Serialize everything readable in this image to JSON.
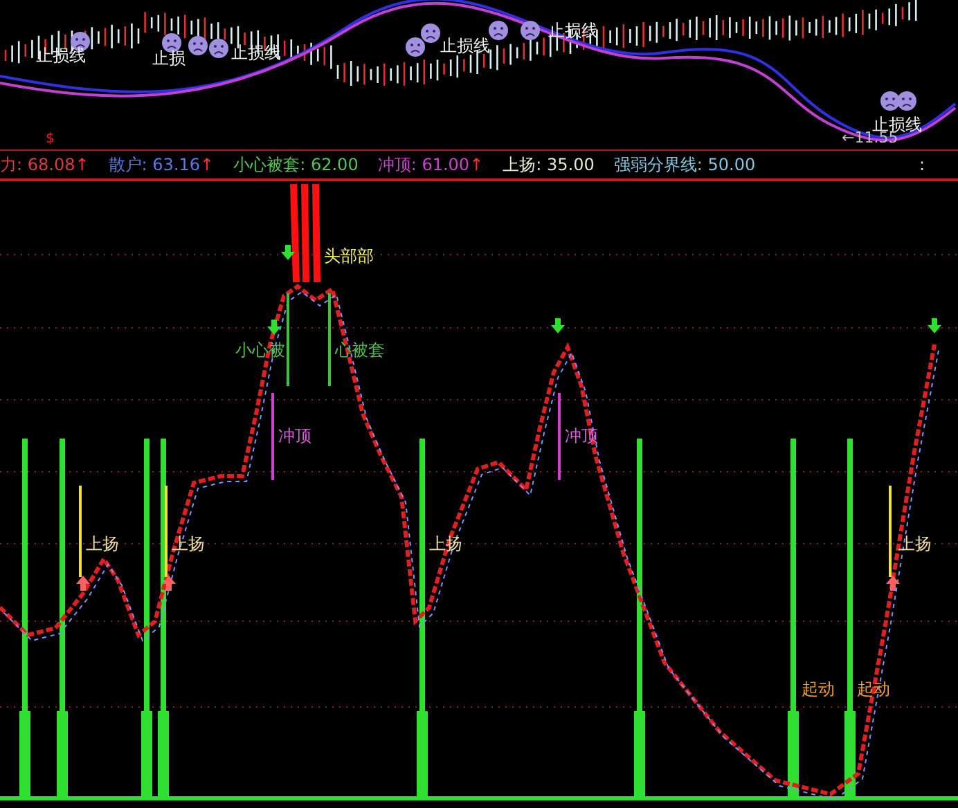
{
  "price_pane": {
    "stop_loss_labels": [
      "止损线",
      "止损",
      "止损线",
      "止损线",
      "止损线",
      "止损线"
    ],
    "marker": "$",
    "price_label": "←11.55"
  },
  "legend": {
    "items": [
      {
        "name": "力:",
        "value": "68.08",
        "arrow": "↑",
        "color": "#e03c3c"
      },
      {
        "name": "散户:",
        "value": "63.16",
        "arrow": "↑",
        "color": "#5a7ae6"
      },
      {
        "name": "小心被套:",
        "value": "62.00",
        "color": "#50c850"
      },
      {
        "name": "冲顶:",
        "value": "61.00",
        "arrow": "↑",
        "color": "#d040d0"
      },
      {
        "name": "上扬:",
        "value": "35.00",
        "color": "#e8e8d0"
      },
      {
        "name": "强弱分界线:",
        "value": "50.00",
        "color": "#80c8e0"
      }
    ],
    "more": ":"
  },
  "indicator_pane": {
    "labels": [
      {
        "kind": "top",
        "text": "头部部"
      },
      {
        "kind": "caution",
        "text": "小心被"
      },
      {
        "kind": "caution",
        "text": "心被套"
      },
      {
        "kind": "peak",
        "text": "冲顶"
      },
      {
        "kind": "peak",
        "text": "冲顶"
      },
      {
        "kind": "rise",
        "text": "上扬"
      },
      {
        "kind": "rise",
        "text": "上扬"
      },
      {
        "kind": "rise",
        "text": "上扬"
      },
      {
        "kind": "rise",
        "text": "上扬"
      },
      {
        "kind": "start",
        "text": "起动"
      },
      {
        "kind": "start",
        "text": "起动"
      }
    ]
  }
}
